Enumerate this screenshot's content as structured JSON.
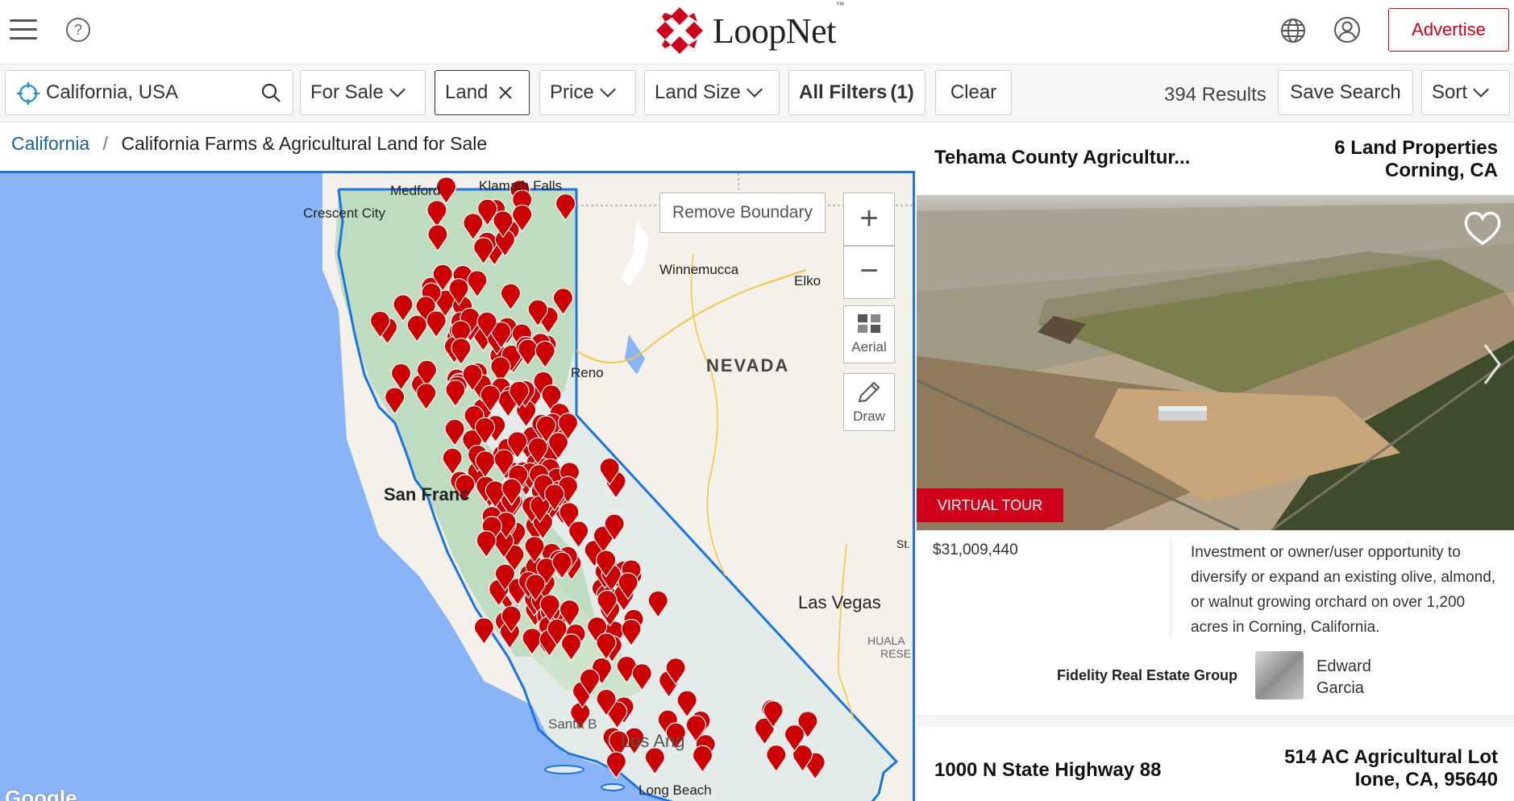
{
  "header": {
    "logo_text": "LoopNet",
    "logo_tm": "™",
    "advertise_label": "Advertise",
    "brand_color": "#d0021b"
  },
  "filters": {
    "search_value": "California, USA",
    "for_sale_label": "For Sale",
    "land_label": "Land",
    "price_label": "Price",
    "land_size_label": "Land Size",
    "all_filters_label": "All Filters",
    "all_filters_count": "(1)",
    "clear_label": "Clear",
    "results_text": "394 Results",
    "save_search_label": "Save Search",
    "sort_label": "Sort"
  },
  "breadcrumb": {
    "link": "California",
    "separator": "/",
    "current": "California Farms & Agricultural Land for Sale"
  },
  "map": {
    "remove_boundary_label": "Remove Boundary",
    "zoom_in": "+",
    "zoom_out": "−",
    "aerial_label": "Aerial",
    "draw_label": "Draw",
    "labels": {
      "medford": "Medford",
      "klamath": "Klamath Falls",
      "crescent": "Crescent City",
      "winnemucca": "Winnemucca",
      "elko": "Elko",
      "nevada": "NEVADA",
      "reno": "Reno",
      "sanfran": "San Franc",
      "lasvegas": "Las Vegas",
      "hualapai": "HUALA",
      "reserv": "RESE",
      "stg": "St.",
      "santab": "Santa B",
      "losang": "Los Ang",
      "longbeach": "Long Beach"
    },
    "google_label": "Google",
    "boundary_color": "#1a73e8",
    "marker_color": "#cc0000"
  },
  "listing1": {
    "title": "Tehama County Agricultur...",
    "sub_line1": "6 Land Properties",
    "sub_line2": "Corning, CA",
    "badge": "VIRTUAL TOUR",
    "price": "$31,009,440",
    "description": "Investment or owner/user opportunity to diversify or expand an existing olive, almond, or walnut growing orchard on over 1,200 acres in Corning, California.",
    "broker": "Fidelity Real Estate Group",
    "agent_first": "Edward",
    "agent_last": "Garcia"
  },
  "listing2": {
    "title": "1000 N State Highway 88",
    "sub_line1": "514 AC Agricultural Lot",
    "sub_line2": "Ione, CA, 95640"
  }
}
